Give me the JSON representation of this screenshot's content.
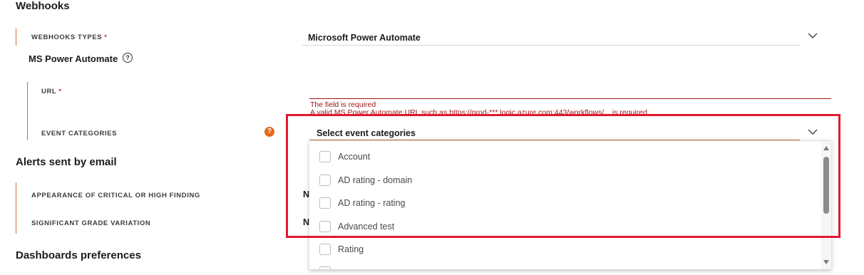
{
  "webhooks": {
    "title": "Webhooks",
    "type_label": "WEBHOOKS TYPES",
    "required_mark": "*",
    "type_value": "Microsoft Power Automate",
    "ms_title": "MS Power Automate",
    "url_label": "URL",
    "url_error_1": "The field is required",
    "url_error_2": "A valid MS Power Automate URL such as https://prod-***.logic.azure.com:443/workflows/... is required",
    "event_label": "EVENT CATEGORIES",
    "event_placeholder": "Select event categories"
  },
  "dropdown": {
    "options": [
      "Account",
      "AD rating - domain",
      "AD rating - rating",
      "Advanced test",
      "Rating"
    ]
  },
  "alerts": {
    "title": "Alerts sent by email",
    "critical_label": "APPEARANCE OF CRITICAL OR HIGH FINDING",
    "critical_value": "Ne",
    "grade_label": "SIGNIFICANT GRADE VARIATION",
    "grade_value": "Ne"
  },
  "dashboards": {
    "title": "Dashboards preferences"
  },
  "colors": {
    "accent": "#c6733a",
    "error": "#a01818",
    "highlight": "#e0192f",
    "help_orange": "#e36a1e"
  }
}
